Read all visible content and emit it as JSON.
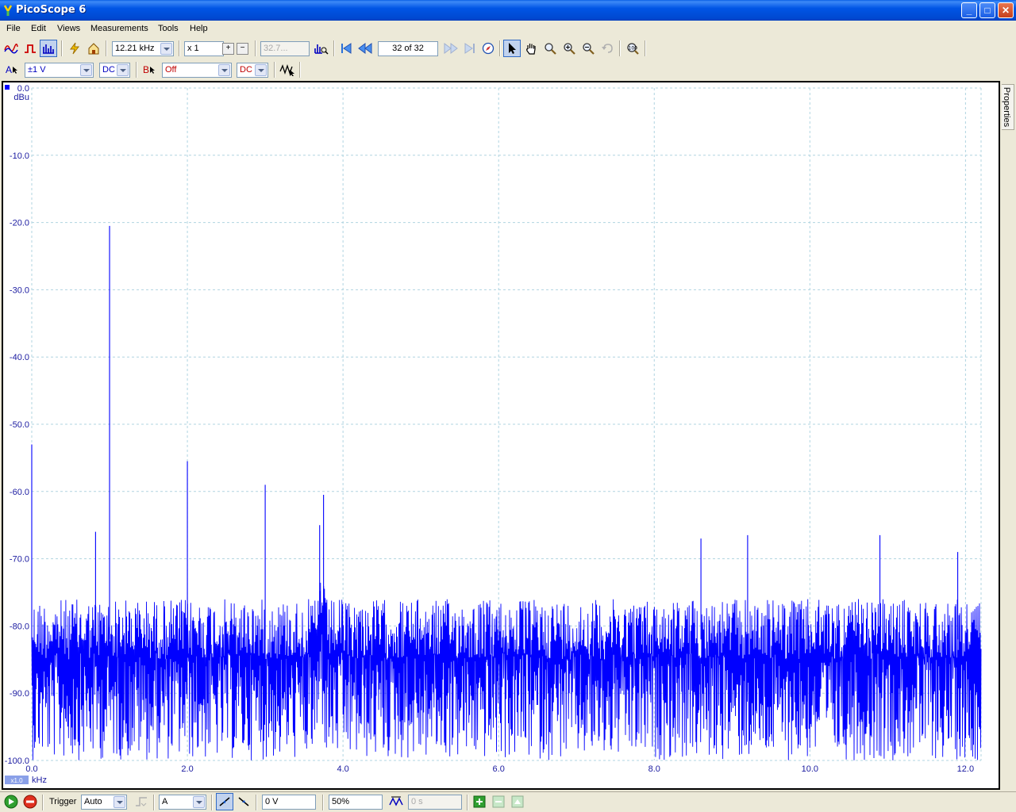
{
  "window": {
    "title": "PicoScope 6",
    "controls": {
      "minimize": "_",
      "maximize": "□",
      "close": "✕"
    }
  },
  "menu": [
    "File",
    "Edit",
    "Views",
    "Measurements",
    "Tools",
    "Help"
  ],
  "toolbar": {
    "frequency": "12.21 kHz",
    "multiplier": "x 1",
    "zoom_value": "32.7...",
    "buffer_position": "32 of 32",
    "icons": [
      "scope-view-icon",
      "persistence-view-icon",
      "spectrum-view-icon",
      "auto-setup-icon",
      "home-icon",
      "zoom-in-value-icon",
      "first-buffer-icon",
      "prev-buffer-icon",
      "next-buffer-icon",
      "last-buffer-icon",
      "compass-icon",
      "pointer-icon",
      "hand-tool-icon",
      "zoom-icon",
      "zoom-in-icon",
      "zoom-out-icon",
      "undo-zoom-icon",
      "zoom-fit-icon"
    ]
  },
  "channels": {
    "a": {
      "label": "A",
      "range": "±1 V",
      "coupling": "DC"
    },
    "b": {
      "label": "B",
      "range": "Off",
      "coupling": "DC"
    }
  },
  "plot": {
    "y_unit": "dBu",
    "x_unit": "kHz",
    "zoom_badge": "x1.0",
    "line_color": "#0000ff",
    "grid_color": "#b0d4e0",
    "y_ticks": [
      "0.0",
      "-10.0",
      "-20.0",
      "-30.0",
      "-40.0",
      "-50.0",
      "-60.0",
      "-70.0",
      "-80.0",
      "-90.0",
      "-100.0"
    ],
    "x_ticks": [
      "0.0",
      "2.0",
      "4.0",
      "6.0",
      "8.0",
      "10.0",
      "12.0"
    ]
  },
  "properties_tab": "Properties",
  "statusbar": {
    "trigger_label": "Trigger",
    "trigger_mode": "Auto",
    "trigger_source": "A",
    "threshold": "0 V",
    "pre_trigger": "50%",
    "delay": "0 s"
  },
  "chart_data": {
    "type": "line",
    "title": "",
    "xlabel": "kHz",
    "ylabel": "dBu",
    "xlim": [
      0.0,
      12.21
    ],
    "ylim": [
      -100.0,
      0.0
    ],
    "grid": true,
    "series": [
      {
        "color": "#0000ff",
        "noise_floor_band": [
          -100.0,
          -75.0
        ],
        "x": [
          0.0,
          0.82,
          1.0,
          2.0,
          3.0,
          3.7,
          3.75,
          8.6,
          9.2,
          10.9,
          11.9
        ],
        "values": [
          -53.0,
          -66.0,
          -20.5,
          -55.5,
          -59.0,
          -65.0,
          -60.5,
          -67.0,
          -66.5,
          -66.5,
          -69.0
        ]
      }
    ]
  }
}
